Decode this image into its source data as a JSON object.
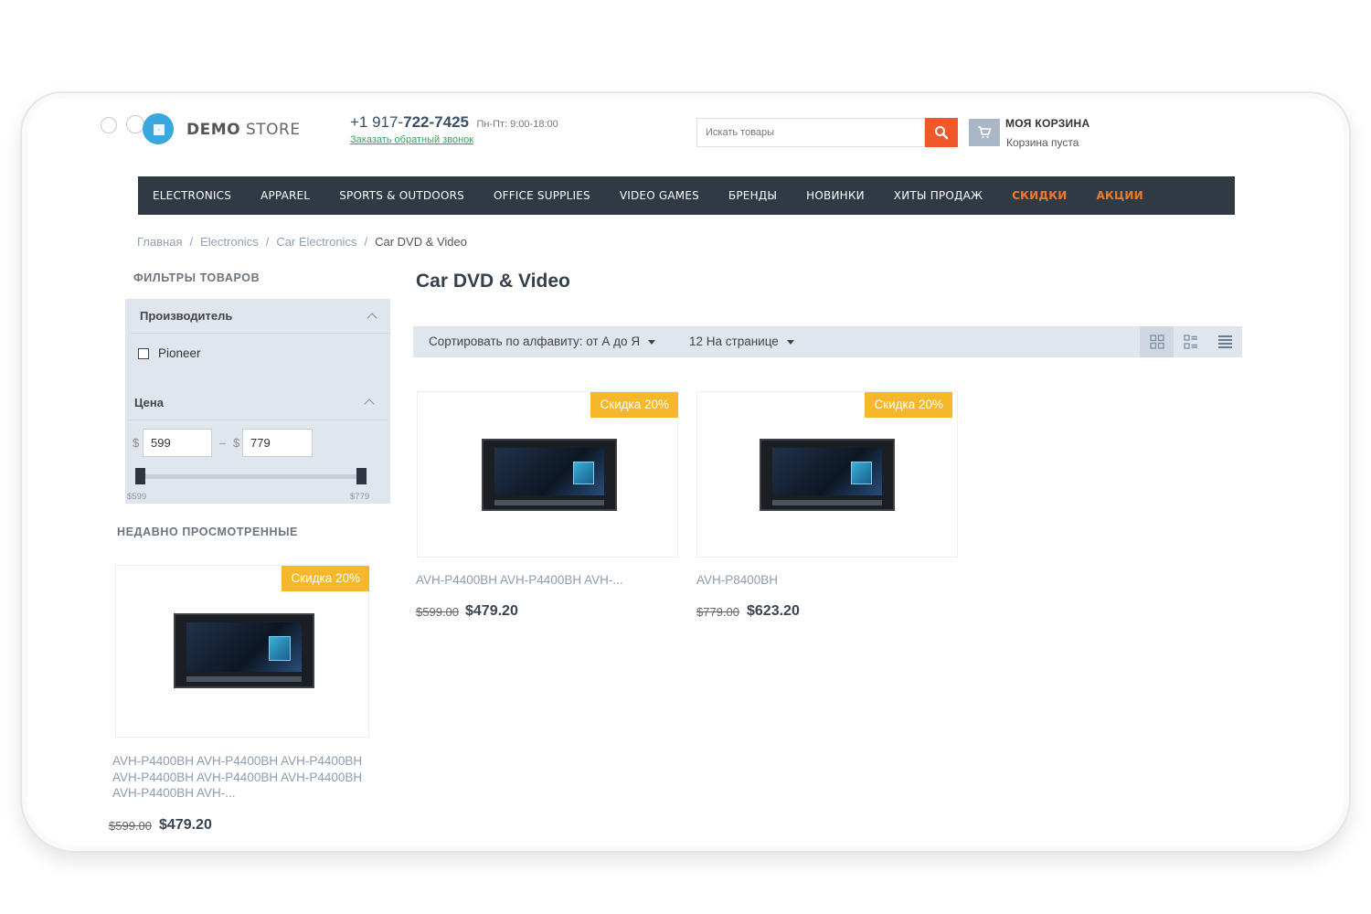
{
  "header": {
    "logo_brand": "DEMO",
    "logo_store": " STORE",
    "phone_prefix": "+1 917-",
    "phone_bold": "722-7425",
    "phone_hours": "Пн-Пт: 9:00-18:00",
    "callback_link": "Заказать обратный звонок",
    "search_placeholder": "Искать товары",
    "cart_title": "МОЯ КОРЗИНА",
    "cart_status": "Корзина пуста"
  },
  "nav": {
    "items": [
      "ELECTRONICS",
      "APPAREL",
      "SPORTS & OUTDOORS",
      "OFFICE SUPPLIES",
      "VIDEO GAMES",
      "БРЕНДЫ",
      "НОВИНКИ",
      "ХИТЫ ПРОДАЖ"
    ],
    "hot_items": [
      "СКИДКИ",
      "АКЦИИ"
    ],
    "hot_color": "#f07a2a"
  },
  "breadcrumb": {
    "items": [
      "Главная",
      "Electronics",
      "Car Electronics"
    ],
    "separator": "/",
    "current": "Car DVD & Video"
  },
  "sidebar": {
    "filters_title": "ФИЛЬТРЫ ТОВАРОВ",
    "manufacturer_title": "Производитель",
    "manufacturer_options": [
      "Pioneer"
    ],
    "price_title": "Цена",
    "currency": "$",
    "price_from": "599",
    "price_to": "779",
    "price_dash": "–",
    "slider_min_label": "$599",
    "slider_max_label": "$779",
    "recent_title": "НЕДАВНО ПРОСМОТРЕННЫЕ",
    "recent_product": {
      "badge": "Скидка 20%",
      "name": "AVH-P4400BH AVH-P4400BH AVH-P4400BH AVH-P4400BH AVH-P4400BH AVH-P4400BH AVH-P4400BH AVH-...",
      "old_price": "$599.00",
      "new_price": "$479.20"
    }
  },
  "main": {
    "title": "Car DVD & Video",
    "sort_label": "Сортировать по алфавиту: от А до Я",
    "per_page_label": "12 На странице",
    "view_modes": [
      "grid-icon",
      "list-grid-icon",
      "list-icon"
    ],
    "products": [
      {
        "badge": "Скидка 20%",
        "name": "AVH-P4400BH AVH-P4400BH AVH-...",
        "old_price": "$599.00",
        "new_price": "$479.20"
      },
      {
        "badge": "Скидка 20%",
        "name": "AVH-P8400BH",
        "old_price": "$779.00",
        "new_price": "$623.20"
      }
    ]
  },
  "colors": {
    "accent": "#f0582a",
    "nav_bg": "#2f3a44",
    "badge": "#f6b82a",
    "panel_bg": "#e0e6ee"
  }
}
